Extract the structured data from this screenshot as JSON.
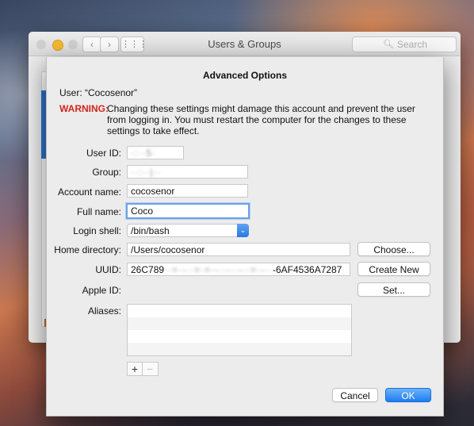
{
  "window": {
    "title": "Users & Groups",
    "search_placeholder": "Search",
    "nav_back": "‹",
    "nav_forward": "›",
    "grid": "⋮⋮⋮"
  },
  "sheet": {
    "title": "Advanced Options",
    "user_line": "User:  “Cocosenor”",
    "warning_label": "WARNING:",
    "warning_text": "Changing these settings might damage this account and prevent the user from logging in. You must restart the computer for the changes to these settings to take effect.",
    "labels": {
      "user_id": "User ID:",
      "group": "Group:",
      "account_name": "Account name:",
      "full_name": "Full name:",
      "login_shell": "Login shell:",
      "home_directory": "Home directory:",
      "uuid": "UUID:",
      "apple_id": "Apple ID:",
      "aliases": "Aliases:"
    },
    "values": {
      "user_id": "·:··5·",
      "group": "··:··|··",
      "account_name": "cocosenor",
      "full_name": "Coco",
      "login_shell": "/bin/bash",
      "home_directory": "/Users/cocosenor",
      "uuid_prefix": "26C789",
      "uuid_masked": "··=·-··=·=·-··-··-··=·-··",
      "uuid_suffix": "-6AF4536A7287"
    },
    "buttons": {
      "choose": "Choose...",
      "create_new": "Create New",
      "set": "Set...",
      "add": "+",
      "remove": "−",
      "cancel": "Cancel",
      "ok": "OK"
    },
    "icons": {
      "select_arrow": "⌄"
    }
  }
}
